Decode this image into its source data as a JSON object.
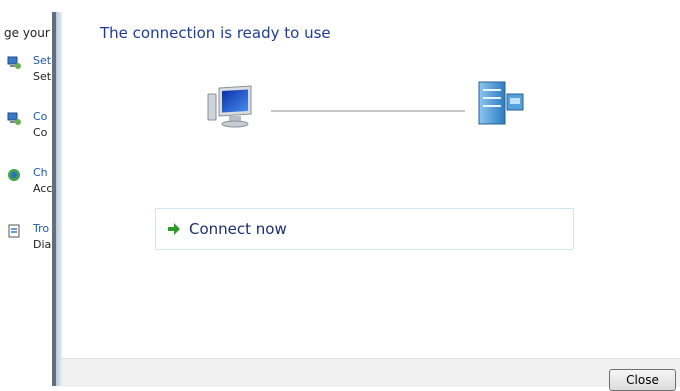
{
  "background_window": {
    "header": "ge your",
    "items": [
      {
        "icon": "network-setup-icon",
        "title": "Set",
        "desc": "Set"
      },
      {
        "icon": "network-connect-icon",
        "title": "Co",
        "desc": "Co"
      },
      {
        "icon": "homegroup-icon",
        "title": "Ch",
        "desc": "Acc"
      },
      {
        "icon": "troubleshoot-icon",
        "title": "Tro",
        "desc": "Dia"
      }
    ]
  },
  "dialog": {
    "title": "The connection is ready to use",
    "connect_label": "Connect now",
    "close_label": "Close"
  },
  "icons": {
    "computer": "computer-icon",
    "server": "server-icon",
    "arrow": "green-arrow-icon"
  },
  "colors": {
    "title": "#1e3c9e",
    "link": "#1e5aa8",
    "arrow": "#2e9a2e"
  }
}
